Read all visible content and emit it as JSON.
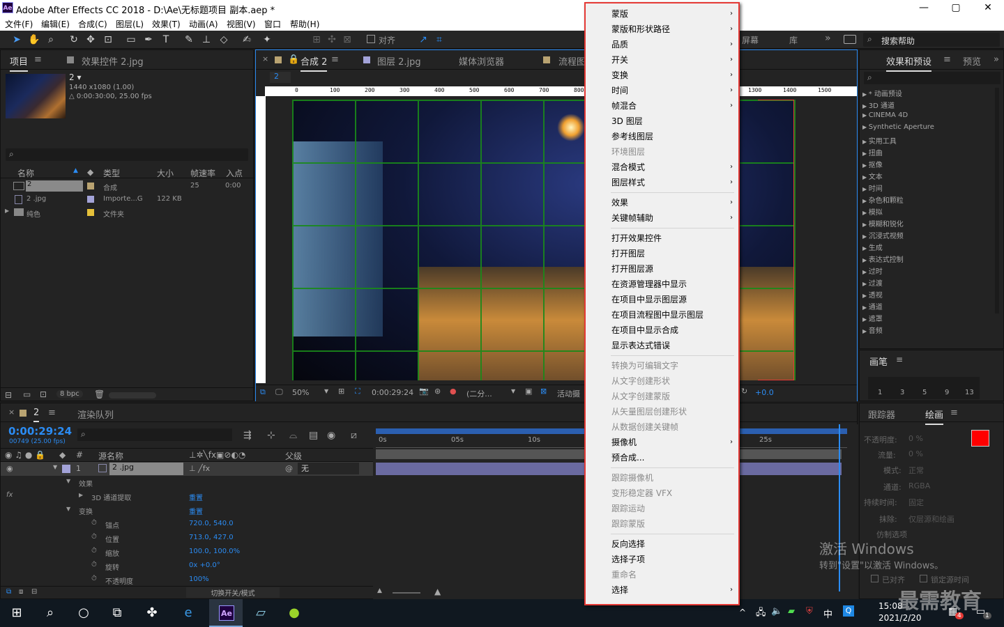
{
  "app": {
    "logo": "Ae",
    "title": "Adobe After Effects CC 2018 - D:\\Ae\\无标题项目 副本.aep *"
  },
  "window_controls": [
    "—",
    "▢",
    "✕"
  ],
  "menu": [
    "文件(F)",
    "编辑(E)",
    "合成(C)",
    "图层(L)",
    "效果(T)",
    "动画(A)",
    "视图(V)",
    "窗口",
    "帮助(H)"
  ],
  "toolbar": {
    "snap_label": "对齐",
    "panels": [
      "屏幕",
      "库"
    ],
    "search_placeholder": "搜索帮助"
  },
  "project_panel": {
    "tabs": [
      "项目",
      "效果控件 2.jpg"
    ],
    "item_name": "2 ▾",
    "item_info1": "1440 x1080 (1.00)",
    "item_info2": "△ 0:00:30:00, 25.00 fps",
    "columns": [
      "名称",
      "类型",
      "大小",
      "帧速率",
      "入点"
    ],
    "rows": [
      {
        "name": "2",
        "type": "合成",
        "size": "",
        "fps": "25",
        "in": "0:00"
      },
      {
        "name": "2 .jpg",
        "type": "Importe...G",
        "size": "122 KB",
        "fps": "",
        "in": ""
      },
      {
        "name": "纯色",
        "type": "文件夹",
        "size": "",
        "fps": "",
        "in": ""
      }
    ],
    "bpc": "8 bpc"
  },
  "comp_panel": {
    "tabs": [
      "合成 2",
      "图层 2.jpg",
      "媒体浏览器",
      "流程图"
    ],
    "breadcrumb": "2",
    "ruler": [
      "0",
      "100",
      "200",
      "300",
      "400",
      "500",
      "600",
      "700",
      "800",
      "1300",
      "1400",
      "1500"
    ],
    "zoom": "50%",
    "timecode": "0:00:29:24",
    "resolution": "(二分...",
    "camera": "活动摄",
    "exposure": "+0.0"
  },
  "effects_panel": {
    "tabs": [
      "效果和预设",
      "预览"
    ],
    "items": [
      "* 动画预设",
      "3D 通道",
      "CINEMA 4D",
      "Synthetic Aperture",
      "实用工具",
      "扭曲",
      "抠像",
      "文本",
      "时间",
      "杂色和颗粒",
      "模拟",
      "模糊和锐化",
      "沉浸式视频",
      "生成",
      "表达式控制",
      "过时",
      "过渡",
      "透视",
      "通道",
      "遮罩",
      "音频"
    ],
    "brush_title": "画笔",
    "brush_sizes": [
      "1",
      "3",
      "5",
      "9",
      "13"
    ]
  },
  "timeline": {
    "tabs": [
      "2",
      "渲染队列"
    ],
    "timecode": "0:00:29:24",
    "frame_info": "00749 (25.00 fps)",
    "col_labels": [
      "源名称",
      "父级"
    ],
    "layer_num": "1",
    "layer_name": "2 .jpg",
    "parent": "无",
    "time_marks": [
      "0s",
      "05s",
      "10s",
      "25s"
    ],
    "props": [
      {
        "name": "效果",
        "value": ""
      },
      {
        "name": "3D 通道提取",
        "value": "重置"
      },
      {
        "name": "变换",
        "value": "重置"
      },
      {
        "name": "锚点",
        "value": "720.0, 540.0"
      },
      {
        "name": "位置",
        "value": "713.0, 427.0"
      },
      {
        "name": "缩放",
        "value": "100.0, 100.0%"
      },
      {
        "name": "旋转",
        "value": "0x +0.0°"
      },
      {
        "name": "不透明度",
        "value": "100%"
      }
    ],
    "footer": "切换开关/模式"
  },
  "paint_panel": {
    "tabs": [
      "跟踪器",
      "绘画"
    ],
    "labels": [
      "不透明度:",
      "流量:",
      "模式:",
      "通道:",
      "持续时间:",
      "抹除:",
      "仿制选项"
    ],
    "values": [
      "0 %",
      "0 %",
      "正常",
      "RGBA",
      "固定",
      "仅层源和绘画",
      ""
    ],
    "checks": [
      "已对齐",
      "锁定源时间"
    ]
  },
  "context_menu": [
    {
      "label": "蒙版",
      "sub": true,
      "dis": false
    },
    {
      "label": "蒙版和形状路径",
      "sub": true,
      "dis": false
    },
    {
      "label": "品质",
      "sub": true,
      "dis": false
    },
    {
      "label": "开关",
      "sub": true,
      "dis": false
    },
    {
      "label": "变换",
      "sub": true,
      "dis": false
    },
    {
      "label": "时间",
      "sub": true,
      "dis": false
    },
    {
      "label": "帧混合",
      "sub": true,
      "dis": false
    },
    {
      "label": "3D 图层",
      "sub": false,
      "dis": false
    },
    {
      "label": "参考线图层",
      "sub": false,
      "dis": false
    },
    {
      "label": "环境图层",
      "sub": false,
      "dis": true
    },
    {
      "label": "混合模式",
      "sub": true,
      "dis": false
    },
    {
      "label": "图层样式",
      "sub": true,
      "dis": false
    },
    {
      "sep": true
    },
    {
      "label": "效果",
      "sub": true,
      "dis": false
    },
    {
      "label": "关键帧辅助",
      "sub": true,
      "dis": false
    },
    {
      "sep": true
    },
    {
      "label": "打开效果控件",
      "sub": false,
      "dis": false
    },
    {
      "label": "打开图层",
      "sub": false,
      "dis": false
    },
    {
      "label": "打开图层源",
      "sub": false,
      "dis": false
    },
    {
      "label": "在资源管理器中显示",
      "sub": false,
      "dis": false
    },
    {
      "label": "在项目中显示图层源",
      "sub": false,
      "dis": false
    },
    {
      "label": "在项目流程图中显示图层",
      "sub": false,
      "dis": false
    },
    {
      "label": "在项目中显示合成",
      "sub": false,
      "dis": false
    },
    {
      "label": "显示表达式错误",
      "sub": false,
      "dis": false
    },
    {
      "sep": true
    },
    {
      "label": "转换为可编辑文字",
      "sub": false,
      "dis": true
    },
    {
      "label": "从文字创建形状",
      "sub": false,
      "dis": true
    },
    {
      "label": "从文字创建蒙版",
      "sub": false,
      "dis": true
    },
    {
      "label": "从矢量图层创建形状",
      "sub": false,
      "dis": true
    },
    {
      "label": "从数据创建关键帧",
      "sub": false,
      "dis": true
    },
    {
      "label": "摄像机",
      "sub": true,
      "dis": false
    },
    {
      "label": "预合成...",
      "sub": false,
      "dis": false
    },
    {
      "sep": true
    },
    {
      "label": "跟踪摄像机",
      "sub": false,
      "dis": true
    },
    {
      "label": "变形稳定器 VFX",
      "sub": false,
      "dis": true
    },
    {
      "label": "跟踪运动",
      "sub": false,
      "dis": true
    },
    {
      "label": "跟踪蒙版",
      "sub": false,
      "dis": true
    },
    {
      "sep": true
    },
    {
      "label": "反向选择",
      "sub": false,
      "dis": false
    },
    {
      "label": "选择子项",
      "sub": false,
      "dis": false
    },
    {
      "label": "重命名",
      "sub": false,
      "dis": true
    },
    {
      "label": "选择",
      "sub": true,
      "dis": false
    }
  ],
  "watermark": {
    "line1": "激活 Windows",
    "line2": "转到\"设置\"以激活 Windows。",
    "brand": "最需教育"
  },
  "taskbar": {
    "time": "15:08",
    "date": "2021/2/20",
    "ime": "中",
    "badge": "4",
    "notif": "1"
  },
  "colors": {
    "accent": "#2b8cf4",
    "paint_fg": "#ff0000",
    "menu_border": "#e53935"
  }
}
